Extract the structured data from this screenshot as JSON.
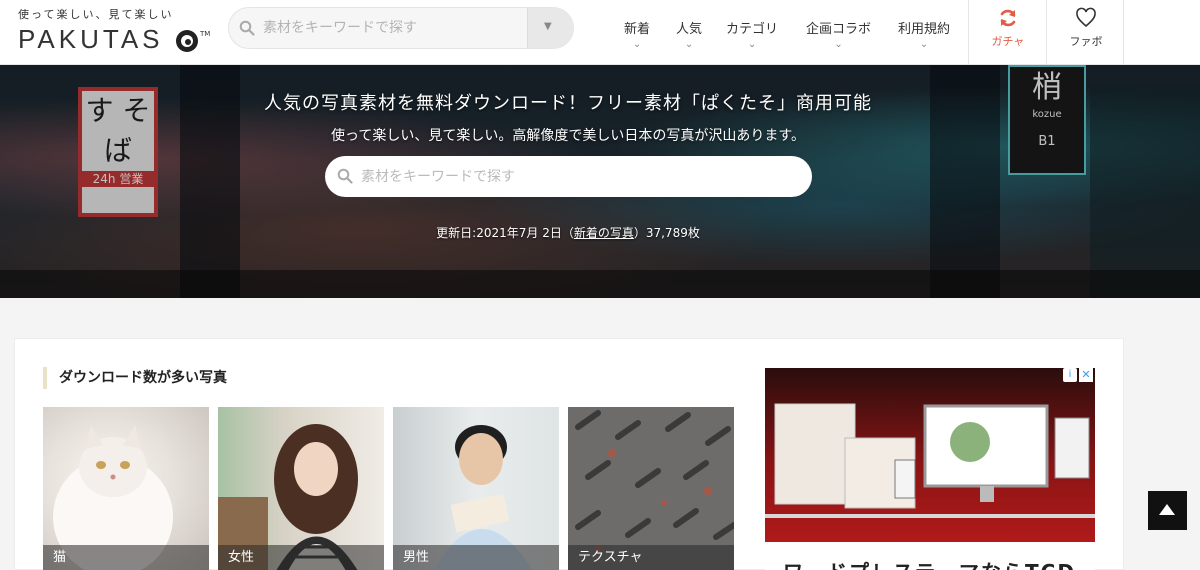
{
  "header": {
    "logo_tagline": "使って楽しい、見て楽しい",
    "logo_text": "PAKUTAS",
    "logo_tm": "TM",
    "search_placeholder": "素材をキーワードで探す",
    "nav": [
      {
        "label": "新着"
      },
      {
        "label": "人気"
      },
      {
        "label": "カテゴリ"
      },
      {
        "label": "企画コラボ"
      },
      {
        "label": "利用規約"
      }
    ],
    "gacha_label": "ガチャ",
    "fav_label": "ファボ",
    "accent_color": "#e25b45"
  },
  "hero": {
    "title": "人気の写真素材を無料ダウンロード！フリー素材「ぱくたそ」商用可能",
    "subtitle": "使って楽しい、見て楽しい。高解像度で美しい日本の写真が沢山あります。",
    "search_placeholder": "素材をキーワードで探す",
    "update_prefix": "更新日:2021年7月 2日（",
    "update_link": "新着の写真",
    "update_suffix": "）37,789枚",
    "sign_left_top": "す そ",
    "sign_left_bottom": "ば",
    "sign_left_badge": "24h 営業",
    "sign_right_kanji": "梢",
    "sign_right_text": "kozue",
    "sign_right_floor": "B1"
  },
  "section": {
    "title": "ダウンロード数が多い写真",
    "photos": [
      {
        "caption": "猫"
      },
      {
        "caption": "女性"
      },
      {
        "caption": "男性"
      },
      {
        "caption": "テクスチャ"
      }
    ]
  },
  "ad": {
    "text": "ワードプレステーマならTCD",
    "info_icon": "i",
    "close_icon": "✕"
  }
}
